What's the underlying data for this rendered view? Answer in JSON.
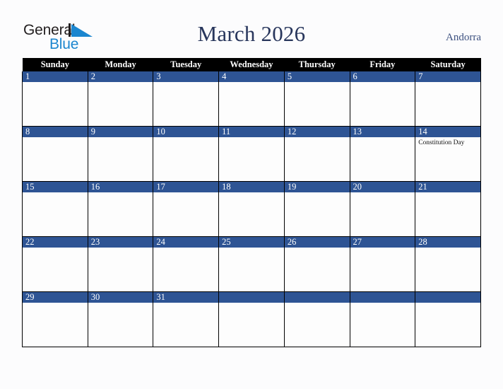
{
  "brand": {
    "name_part1": "General",
    "name_part2": "Blue",
    "accent_color": "#1b86cf"
  },
  "header": {
    "title": "March 2026",
    "country": "Andorra",
    "title_color": "#28365c"
  },
  "calendar": {
    "weekday_headers": [
      "Sunday",
      "Monday",
      "Tuesday",
      "Wednesday",
      "Thursday",
      "Friday",
      "Saturday"
    ],
    "header_bg": "#000000",
    "daynum_bg": "#2e5494",
    "weeks": [
      [
        {
          "day": "1",
          "events": []
        },
        {
          "day": "2",
          "events": []
        },
        {
          "day": "3",
          "events": []
        },
        {
          "day": "4",
          "events": []
        },
        {
          "day": "5",
          "events": []
        },
        {
          "day": "6",
          "events": []
        },
        {
          "day": "7",
          "events": []
        }
      ],
      [
        {
          "day": "8",
          "events": []
        },
        {
          "day": "9",
          "events": []
        },
        {
          "day": "10",
          "events": []
        },
        {
          "day": "11",
          "events": []
        },
        {
          "day": "12",
          "events": []
        },
        {
          "day": "13",
          "events": []
        },
        {
          "day": "14",
          "events": [
            "Constitution Day"
          ]
        }
      ],
      [
        {
          "day": "15",
          "events": []
        },
        {
          "day": "16",
          "events": []
        },
        {
          "day": "17",
          "events": []
        },
        {
          "day": "18",
          "events": []
        },
        {
          "day": "19",
          "events": []
        },
        {
          "day": "20",
          "events": []
        },
        {
          "day": "21",
          "events": []
        }
      ],
      [
        {
          "day": "22",
          "events": []
        },
        {
          "day": "23",
          "events": []
        },
        {
          "day": "24",
          "events": []
        },
        {
          "day": "25",
          "events": []
        },
        {
          "day": "26",
          "events": []
        },
        {
          "day": "27",
          "events": []
        },
        {
          "day": "28",
          "events": []
        }
      ],
      [
        {
          "day": "29",
          "events": []
        },
        {
          "day": "30",
          "events": []
        },
        {
          "day": "31",
          "events": []
        },
        {
          "day": "",
          "events": []
        },
        {
          "day": "",
          "events": []
        },
        {
          "day": "",
          "events": []
        },
        {
          "day": "",
          "events": []
        }
      ]
    ]
  }
}
